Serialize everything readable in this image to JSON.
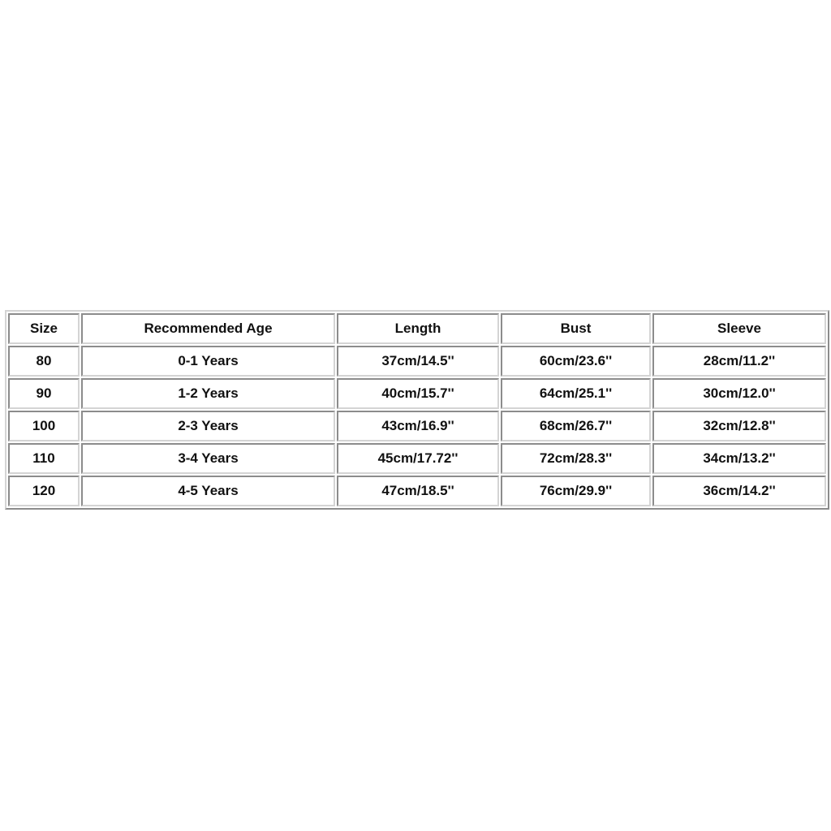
{
  "size_chart": {
    "headers": [
      "Size",
      "Recommended Age",
      "Length",
      "Bust",
      "Sleeve"
    ],
    "rows": [
      [
        "80",
        "0-1 Years",
        "37cm/14.5''",
        "60cm/23.6''",
        "28cm/11.2''"
      ],
      [
        "90",
        "1-2 Years",
        "40cm/15.7''",
        "64cm/25.1''",
        "30cm/12.0''"
      ],
      [
        "100",
        "2-3 Years",
        "43cm/16.9''",
        "68cm/26.7''",
        "32cm/12.8''"
      ],
      [
        "110",
        "3-4 Years",
        "45cm/17.72''",
        "72cm/28.3''",
        "34cm/13.2''"
      ],
      [
        "120",
        "4-5 Years",
        "47cm/18.5''",
        "76cm/29.9''",
        "36cm/14.2''"
      ]
    ]
  },
  "colors": {
    "background": "#ffffff",
    "text": "#111111",
    "border_light": "#d4d4d4",
    "border_dark": "#8c8c8c"
  }
}
